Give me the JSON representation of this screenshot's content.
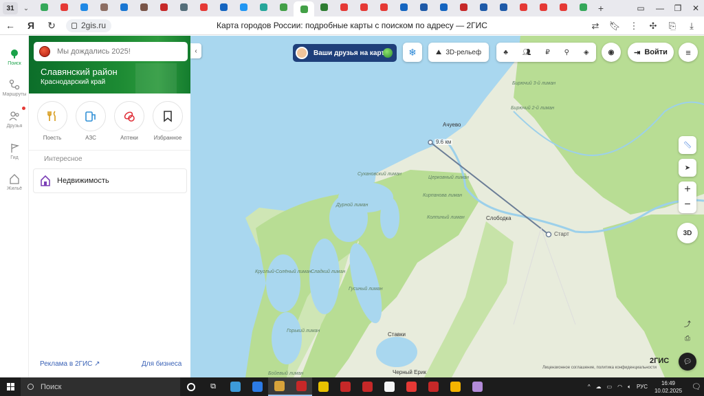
{
  "browser": {
    "tab_counter": "31",
    "url": "2gis.ru",
    "page_title": "Карта городов России: подробные карты с поиском по адресу — 2ГИС",
    "tab_colors": [
      "#35a85a",
      "#e53935",
      "#1e88e5",
      "#8d6e63",
      "#1976d2",
      "#795548",
      "#c62828",
      "#546e7a",
      "#e53935",
      "#1565c0",
      "#2196f3",
      "#26a69a",
      "#43a047",
      "#43a047",
      "#2e7d32",
      "#e53935",
      "#e53935",
      "#e53935",
      "#1565c0",
      "#1e5aa8",
      "#1565c0",
      "#c62828",
      "#1e5aa8",
      "#1e5aa8",
      "#e53935",
      "#e53935",
      "#e53935",
      "#35a85a"
    ]
  },
  "sidebar": {
    "items": [
      {
        "label": "Поиск",
        "icon": "search-icon",
        "active": true
      },
      {
        "label": "Маршруты",
        "icon": "routes-icon"
      },
      {
        "label": "Друзья",
        "icon": "friends-icon"
      },
      {
        "label": "Гид",
        "icon": "guide-icon"
      },
      {
        "label": "Жильё",
        "icon": "housing-icon"
      }
    ]
  },
  "panel": {
    "search_placeholder": "Мы дождались 2025!",
    "region_name": "Славянский район",
    "region_sub": "Краснодарский край",
    "quick": [
      {
        "label": "Поесть",
        "icon": "fork-knife-icon"
      },
      {
        "label": "АЗС",
        "icon": "fuel-icon"
      },
      {
        "label": "Аптеки",
        "icon": "pills-icon"
      },
      {
        "label": "Избранное",
        "icon": "bookmark-icon"
      }
    ],
    "section_label": "Интересное",
    "estate_label": "Недвижимость",
    "footer_ad": "Реклама в 2ГИС ↗",
    "footer_business": "Для бизнеса"
  },
  "map": {
    "friends_banner": "Ваши друзья на карте!",
    "relief_label": "3D-рельеф",
    "login_label": "Войти",
    "zoom_in": "+",
    "zoom_out": "−",
    "view_3d": "3D",
    "distance_label": "9.6 км",
    "start_label": "Старт",
    "places": [
      "Ачуево",
      "Слободка",
      "Сухановский лиман",
      "Церковный лиман",
      "Кирпанова лиман",
      "Дурной лиман",
      "Колпиный лиман",
      "Круглый-Солёный лиман",
      "Сладкий лиман",
      "Гусиный лиман",
      "Горький лиман",
      "Ставки",
      "Бирючий 3-й лиман",
      "Бирючий 2-й лиман",
      "Черный Ерик",
      "Бойевый лиман"
    ],
    "copyright": "Лицензионное соглашение, политика конфиденциальности",
    "brand": "2ГИС"
  },
  "taskbar": {
    "search_placeholder": "Поиск",
    "language": "РУС",
    "time": "16:49",
    "date": "10.02.2025",
    "app_colors": [
      "#3d9bd9",
      "#2c7be5",
      "#d8a33a",
      "#c62828",
      "#e8c100",
      "#c62828",
      "#c62828",
      "#f5f5f5",
      "#e53935",
      "#c62828",
      "#f4b400",
      "#b38bd9"
    ]
  }
}
